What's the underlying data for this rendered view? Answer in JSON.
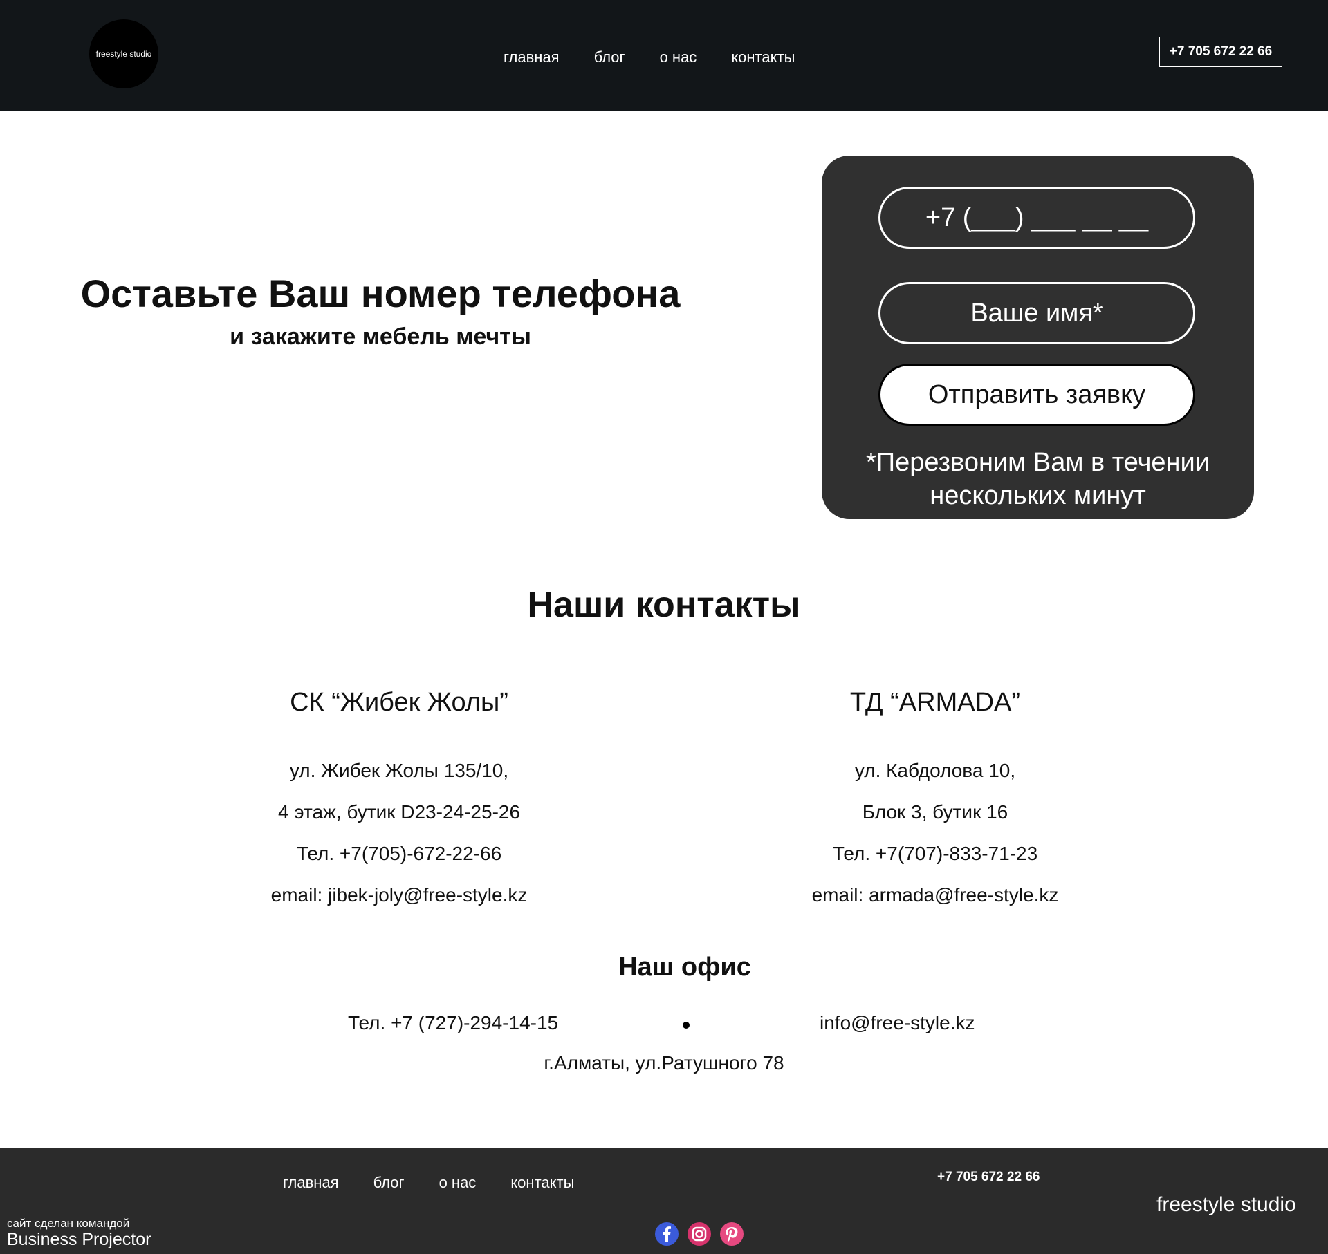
{
  "header": {
    "logo_text": "freestyle studio",
    "nav": [
      "главная",
      "блог",
      "о нас",
      "контакты"
    ],
    "phone": "+7 705 672 22 66"
  },
  "hero": {
    "title": "Оставьте Ваш номер телефона",
    "subtitle": "и закажите мебель мечты"
  },
  "form": {
    "phone_placeholder": "+7 (___) ___ __ __",
    "name_placeholder": "Ваше имя*",
    "submit_label": "Отправить заявку",
    "note": "*Перезвоним Вам в течении нескольких минут"
  },
  "contacts": {
    "title": "Наши контакты",
    "stores": [
      {
        "name": "СК “Жибек Жолы”",
        "address1": "ул. Жибек Жолы 135/10,",
        "address2": "4 этаж, бутик D23-24-25-26",
        "phone": "Тел. +7(705)-672-22-66",
        "email": "email: jibek-joly@free-style.kz"
      },
      {
        "name": "ТД “ARMADA”",
        "address1": "ул. Кабдолова 10,",
        "address2": "Блок 3, бутик 16",
        "phone": "Тел. +7(707)-833-71-23",
        "email": "email: armada@free-style.kz"
      }
    ],
    "office": {
      "title": "Наш офис",
      "phone": "Тел. +7 (727)-294-14-15",
      "email": "info@free-style.kz",
      "address": "г.Алматы, ул.Ратушного 78"
    }
  },
  "footer": {
    "nav": [
      "главная",
      "блог",
      "о нас",
      "контакты"
    ],
    "phone": "+7 705 672 22 66",
    "brand": "freestyle studio",
    "credit_line1": "сайт сделан командой",
    "credit_line2": "Business Projector",
    "social_icons": [
      "facebook-icon",
      "instagram-icon",
      "pinterest-icon"
    ]
  },
  "colors": {
    "header_bg": "#121619",
    "card_bg": "#303030",
    "footer_bg": "#2b2b2b"
  }
}
